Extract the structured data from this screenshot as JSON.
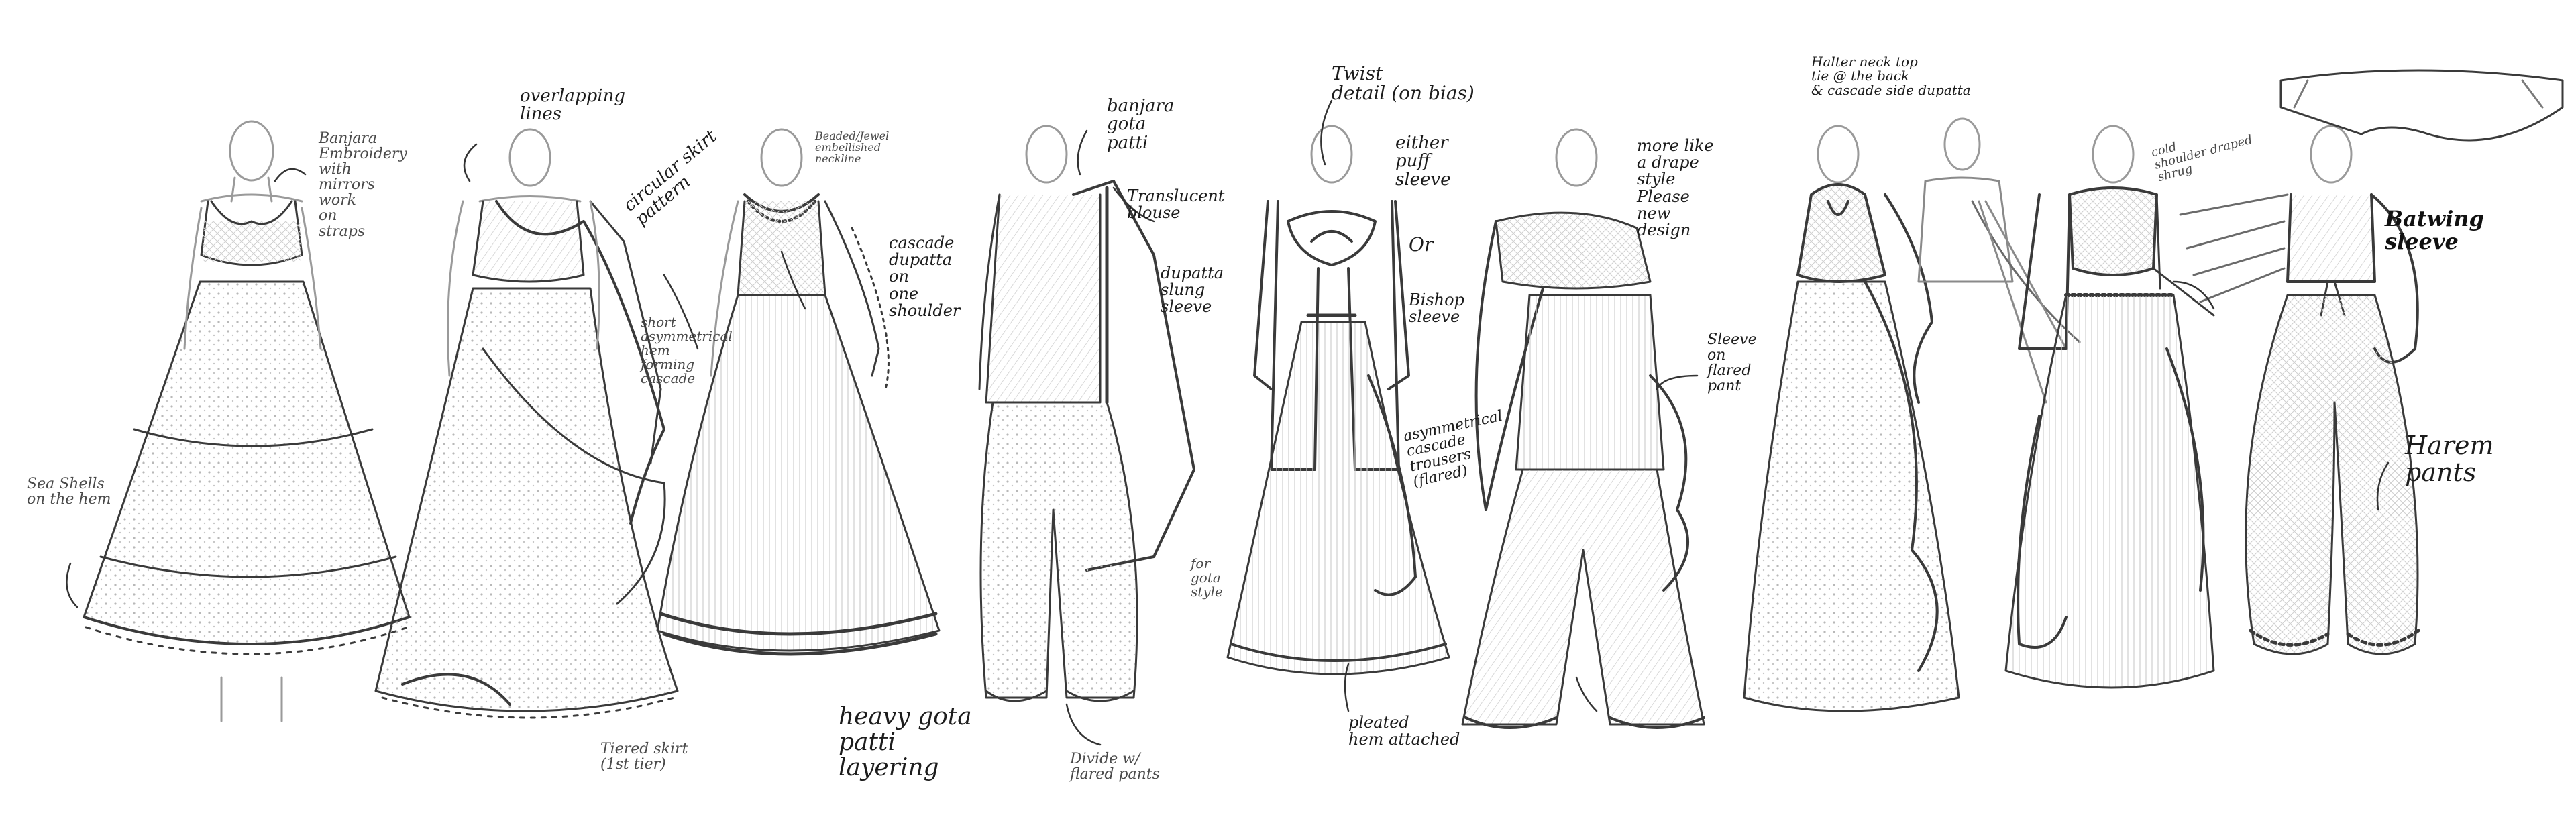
{
  "sheet": {
    "notes": {
      "n1": "Banjara\nEmbroidery\nwith\nmirrors\nwork\non\nstraps",
      "n2": "Sea Shells\non the hem",
      "n3": "overlapping\nlines",
      "n4": "circular skirt\npattern",
      "n5": "short\nasymmetrical\nhem\nforming\ncascade",
      "n6": "Tiered skirt\n(1st tier)",
      "n7": "Beaded/Jewel\nembellished\nneckline",
      "n8": "cascade\ndupatta\non\none\nshoulder",
      "n9": "heavy gota\npatti\nlayering",
      "n10": "banjara\ngota\npatti",
      "n11": "Translucent\nblouse",
      "n12": "dupatta\nslung\nsleeve",
      "n13": "for\ngota\nstyle",
      "n14": "Divide w/\nflared pants",
      "n15": "Twist\ndetail (on bias)",
      "n16": "either\npuff\nsleeve",
      "n17": "Or",
      "n18": "Bishop\nsleeve",
      "n19": "asymmetrical\ncascade\ntrousers\n(flared)",
      "n20": "pleated\nhem attached",
      "n21": "more like\na drape\nstyle\nPlease\nnew\ndesign",
      "n22": "Sleeve\non\nflared\npant",
      "n23": "Halter neck top\ntie @ the back\n& cascade side dupatta",
      "n24": "cold\nshoulder draped\nshrug",
      "n25": "Batwing\nsleeve",
      "n26": "Harem\npants"
    }
  }
}
